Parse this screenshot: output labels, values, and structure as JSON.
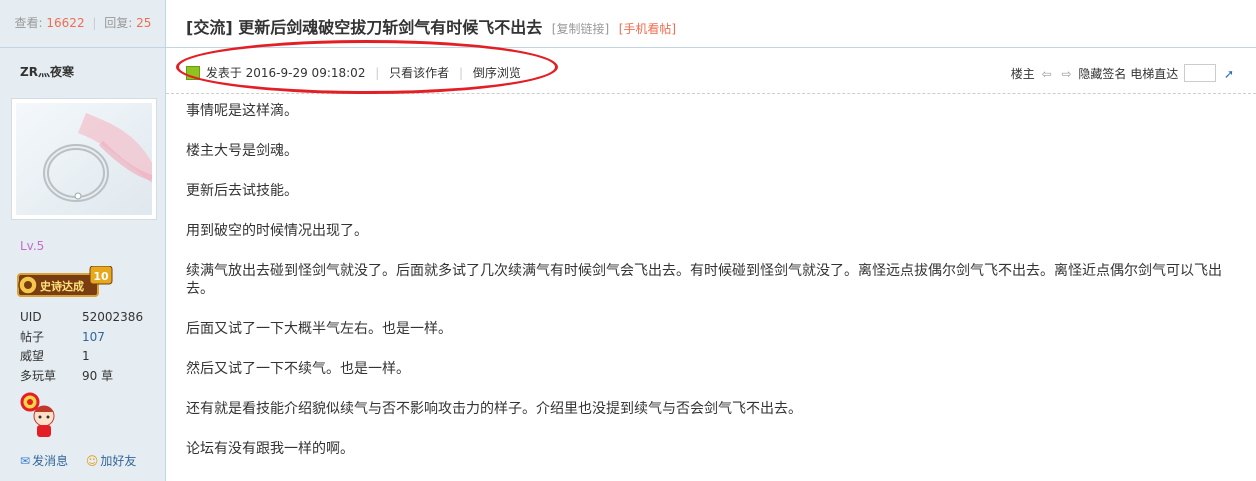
{
  "stats": {
    "view_label": "查看:",
    "views": "16622",
    "reply_label": "回复:",
    "replies": "25"
  },
  "author": {
    "name": "ZR灬夜寒",
    "level": "Lv.5",
    "medal_text": "史诗达成",
    "medal_badge": "10",
    "profile": [
      {
        "label": "UID",
        "value": "52002386"
      },
      {
        "label": "帖子",
        "value": "107"
      },
      {
        "label": "威望",
        "value": "1"
      },
      {
        "label": "多玩草",
        "value": "90 草"
      }
    ],
    "send_message": "发消息",
    "add_friend": "加好友"
  },
  "thread": {
    "title": "[交流] 更新后剑魂破空拔刀斩剑气有时候飞不出去",
    "copy_link": "[复制链接]",
    "mobile": "[手机看帖]"
  },
  "post": {
    "posted_at": "发表于 2016-9-29 09:18:02",
    "only_author": "只看该作者",
    "reverse": "倒序浏览",
    "floor": "楼主",
    "hide_sign": "隐藏签名",
    "elevator": "电梯直达",
    "paragraphs": [
      "事情呢是这样滴。",
      "楼主大号是剑魂。",
      "更新后去试技能。",
      "用到破空的时候情况出现了。",
      "续满气放出去碰到怪剑气就没了。后面就多试了几次续满气有时候剑气会飞出去。有时候碰到怪剑气就没了。离怪远点拔偶尔剑气飞不出去。离怪近点偶尔剑气可以飞出去。",
      "后面又试了一下大概半气左右。也是一样。",
      "然后又试了一下不续气。也是一样。",
      "还有就是看技能介绍貌似续气与否不影响攻击力的样子。介绍里也没提到续气与否会剑气飞不出去。",
      "论坛有没有跟我一样的啊。"
    ]
  },
  "colors": {
    "sidebar_bg": "#e5edf2",
    "accent": "#f26c4f",
    "link": "#336699",
    "annotation": "#e31e25"
  }
}
